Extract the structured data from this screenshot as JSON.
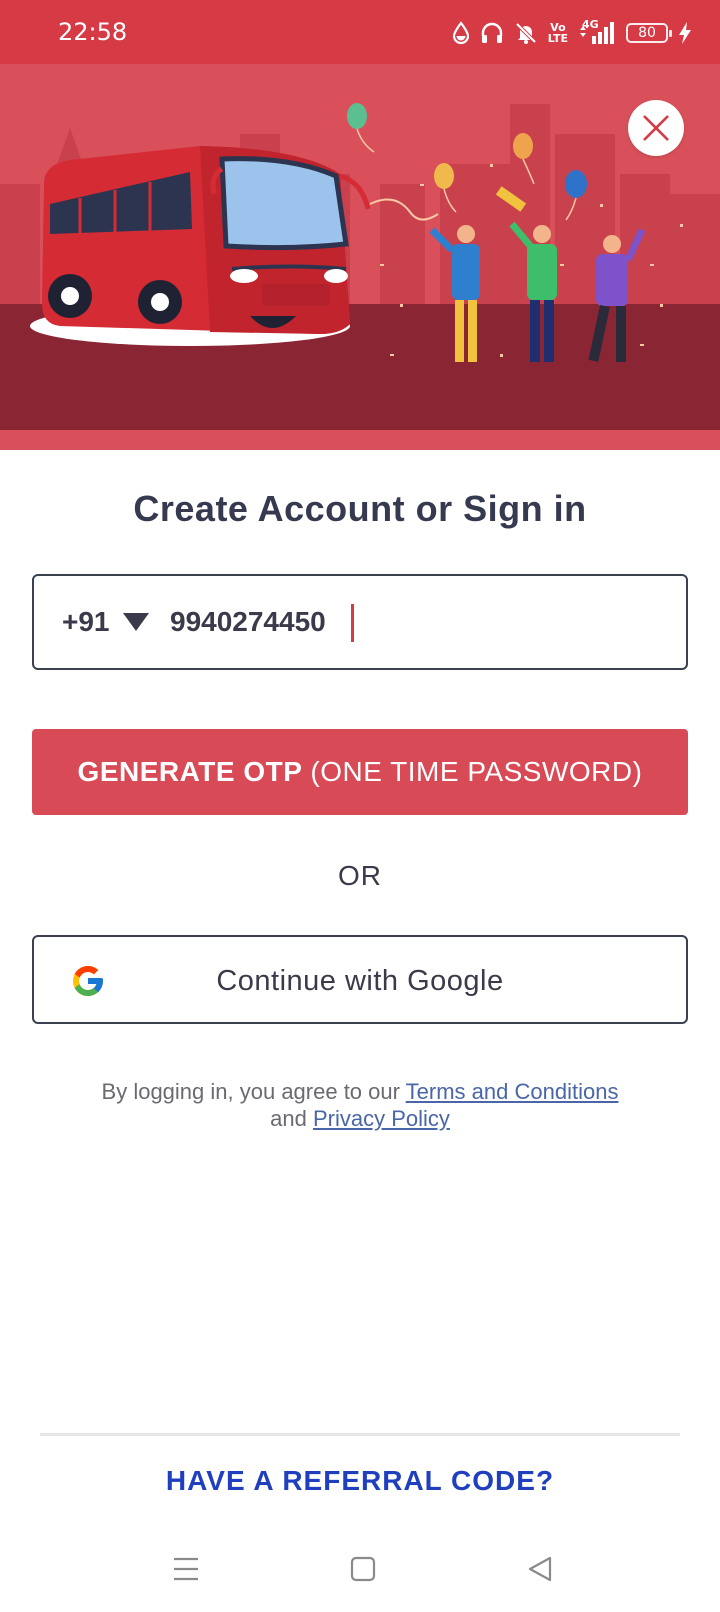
{
  "status_bar": {
    "time": "22:58",
    "icons": [
      "water-drop-icon",
      "headphones-icon",
      "mute-icon",
      "volte-icon",
      "signal-icon",
      "battery-icon",
      "charging-icon"
    ],
    "volte_top": "Vo",
    "volte_bottom": "LTE",
    "network": "4G",
    "battery": "80"
  },
  "hero": {
    "illustration": "bus-celebration-illustration",
    "close_icon": "close-icon"
  },
  "login": {
    "title": "Create Account or Sign in",
    "country_code": "+91",
    "phone_value": "9940274450",
    "otp_bold": "GENERATE OTP",
    "otp_light": "(ONE TIME PASSWORD)",
    "or_text": "OR",
    "google_label": "Continue with Google",
    "legal_prefix": "By logging in, you agree to our",
    "terms_link": "Terms and Conditions",
    "legal_and": "and",
    "privacy_link": "Privacy Policy",
    "referral": "HAVE A REFERRAL CODE?"
  },
  "colors": {
    "brand": "#d84a56",
    "status_bar": "#d53a45",
    "referral": "#1f3fbf",
    "link": "#4a66a8"
  },
  "nav": {
    "items": [
      "menu-icon",
      "home-square-icon",
      "back-triangle-icon"
    ]
  }
}
